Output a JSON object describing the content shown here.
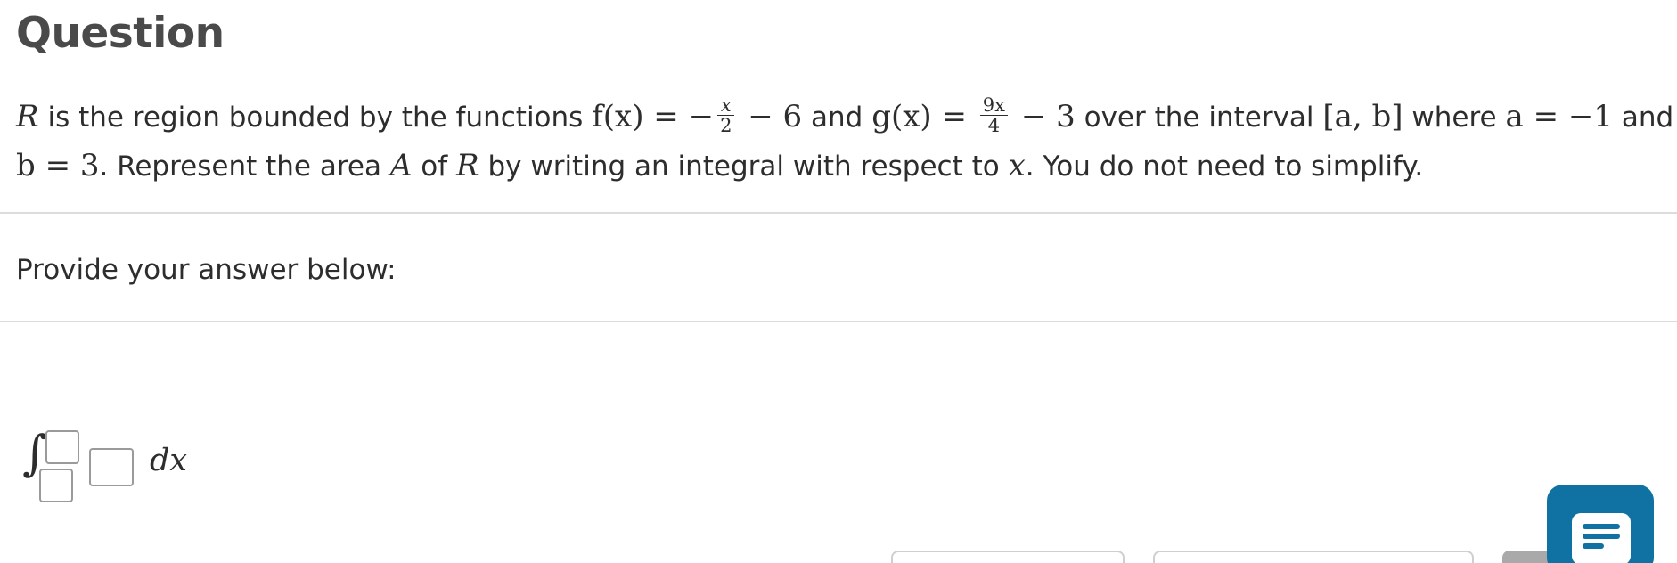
{
  "header": {
    "title": "Question"
  },
  "question": {
    "line1": {
      "seg1": "R",
      "seg2": " is the region bounded by the functions ",
      "f_expr": "f(x) = −",
      "f_num": "x",
      "f_den": "2",
      "f_tail": " − 6",
      "and1": " and ",
      "g_expr": "g(x) = ",
      "g_num": "9x",
      "g_den": "4",
      "g_tail": " − 3",
      "seg3": " over the interval ",
      "interval": "[a, b]",
      "seg4": " where ",
      "a_expr": "a = −1",
      "and2": " and"
    },
    "line2": {
      "b_expr": "b = 3",
      "seg5": ". Represent the area ",
      "A": "A",
      "seg6": " of ",
      "R": "R",
      "seg7": " by writing an integral with respect to ",
      "x": "x",
      "seg8": ". You do not need to simplify."
    }
  },
  "answer": {
    "prompt": "Provide your answer below:",
    "integral_symbol": "∫",
    "differential": "dx"
  },
  "colors": {
    "accent": "#0f72a3",
    "divider": "#dcdcdc",
    "text": "#2d2d2d"
  },
  "icons": {
    "chat": "chat-bubble-icon"
  }
}
